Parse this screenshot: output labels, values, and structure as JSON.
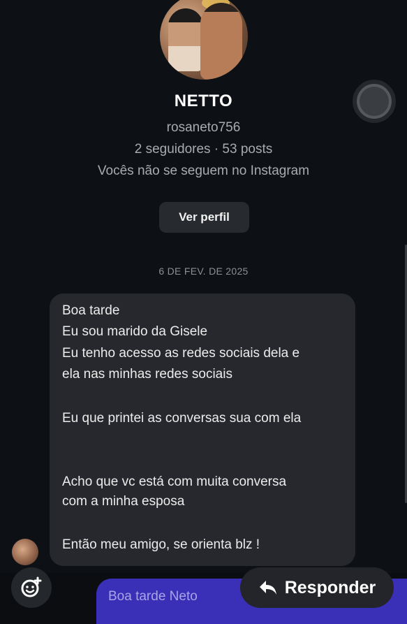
{
  "profile": {
    "name": "NETTO",
    "username": "rosaneto756",
    "stats": "2 seguidores · 53 posts",
    "follow_status": "Vocês não se seguem no Instagram",
    "view_profile_label": "Ver perfil"
  },
  "conversation": {
    "date": "6 DE FEV. DE 2025",
    "message_lines": [
      "Boa tarde",
      "Eu sou marido da Gisele",
      "Eu tenho acesso as redes sociais dela e",
      "ela nas minhas redes sociais",
      "Eu que printei as conversas sua com ela",
      "Acho que vc está com muita conversa",
      "com a minha esposa",
      "Então meu amigo, se orienta blz !"
    ]
  },
  "composer": {
    "reply_preview": "Boa tarde Neto",
    "reply_button_label": "Responder"
  },
  "icons": {
    "sticker": "sticker-add-icon",
    "reply": "reply-arrow-icon"
  },
  "colors": {
    "background": "#0d1014",
    "bubble": "#26282d",
    "accent": "#3a30b8"
  }
}
